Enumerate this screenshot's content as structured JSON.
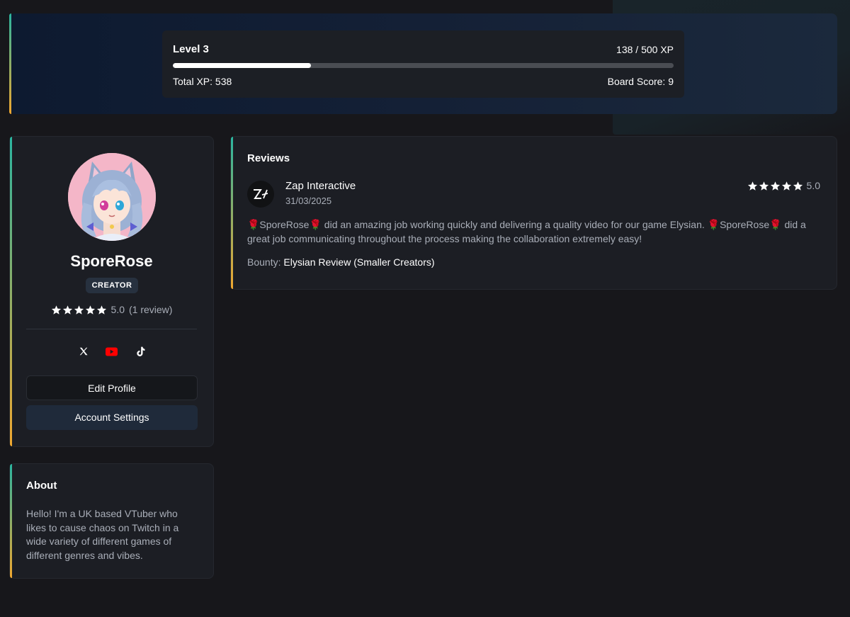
{
  "level": {
    "label": "Level 3",
    "progress_text": "138 / 500 XP",
    "progress_fraction": 0.276,
    "total_xp": "Total XP: 538",
    "board_score": "Board Score: 9"
  },
  "profile": {
    "name": "SporeRose",
    "role": "CREATOR",
    "rating": "5.0",
    "review_count": "(1 review)",
    "socials": [
      "x-icon",
      "youtube-icon",
      "tiktok-icon"
    ],
    "edit_label": "Edit Profile",
    "settings_label": "Account Settings"
  },
  "about": {
    "title": "About",
    "text": "Hello! I'm a UK based VTuber who likes to cause chaos on Twitch in a wide variety of different games of different genres and vibes."
  },
  "reviews": {
    "title": "Reviews",
    "items": [
      {
        "reviewer": "Zap Interactive",
        "date": "31/03/2025",
        "rating": "5.0",
        "text": "🌹SporeRose🌹 did an amazing job working quickly and delivering a quality video for our game Elysian. 🌹SporeRose🌹 did a great job communicating throughout the process making the collaboration extremely easy!",
        "bounty_label": "Bounty:",
        "bounty_value": "Elysian Review (Smaller Creators)"
      }
    ]
  },
  "colors": {
    "background": "#17171b",
    "card": "#1c1e24",
    "accent_top": "#2bb5a0",
    "accent_bottom": "#f0a830",
    "youtube": "#ff0000"
  }
}
